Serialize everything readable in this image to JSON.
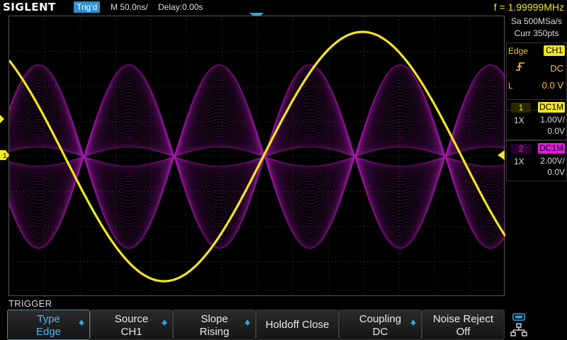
{
  "topbar": {
    "logo": "SIGLENT",
    "trigger_status": "Trig'd",
    "timebase": "M 50.0ns/",
    "delay": "Delay:0.00s",
    "frequency": "f = 1.99999MHz"
  },
  "acquisition": {
    "sample_rate": "Sa 500MSa/s",
    "memory": "Curr 350pts"
  },
  "trigger_info": {
    "type_label": "Edge",
    "source": "CH1",
    "coupling": "DC",
    "level_label": "L",
    "level_value": "0.0 V"
  },
  "channels": [
    {
      "number": "1",
      "coupling": "DC1M",
      "probe": "1X",
      "scale": "1.00V/",
      "offset": "0.0V",
      "color": "#f2e81a"
    },
    {
      "number": "2",
      "coupling": "DC1M",
      "probe": "1X",
      "scale": "2.00V/",
      "offset": "0.0V",
      "color": "#e31ae3"
    }
  ],
  "markers": {
    "ch1": "1"
  },
  "menu": {
    "title": "TRIGGER",
    "softkeys": [
      {
        "line1": "Type",
        "line2": "Edge",
        "arrow": true,
        "active": true
      },
      {
        "line1": "Source",
        "line2": "CH1",
        "arrow": true,
        "active": false
      },
      {
        "line1": "Slope",
        "line2": "Rising",
        "arrow": true,
        "active": false
      },
      {
        "line1": "Holdoff Close",
        "line2": "",
        "arrow": false,
        "active": false
      },
      {
        "line1": "Coupling",
        "line2": "DC",
        "arrow": true,
        "active": false
      },
      {
        "line1": "Noise Reject",
        "line2": "Off",
        "arrow": false,
        "active": false
      }
    ]
  },
  "colors": {
    "accent": "#2a8fd0",
    "ch1": "#f2e81a",
    "ch2": "#e31ae3",
    "grid": "#3c3c3c"
  }
}
